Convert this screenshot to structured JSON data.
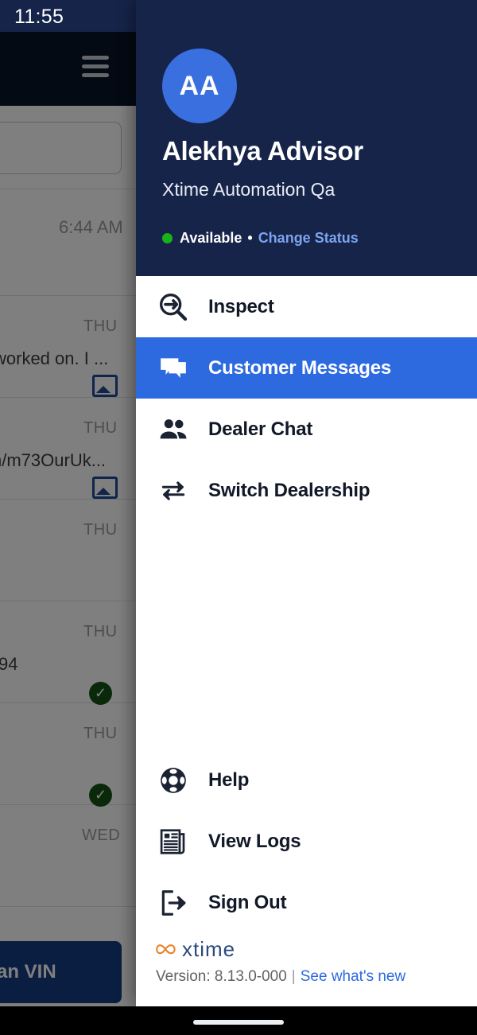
{
  "status_bar": {
    "time": "11:55",
    "icons": [
      "wifi-icon",
      "cellular-signal-icon",
      "battery-icon"
    ]
  },
  "background_app": {
    "hamburger_icon": "hamburger-menu-icon",
    "search_placeholder": "",
    "rows": [
      {
        "day": "",
        "time": "6:44 AM",
        "snippet": "",
        "has_image": false,
        "has_check": false
      },
      {
        "day": "THU",
        "time": "",
        "snippet": "worked on. I ...",
        "has_image": true,
        "has_check": false
      },
      {
        "day": "THU",
        "time": "",
        "snippet": "n/m73OurUk...",
        "has_image": true,
        "has_check": false
      },
      {
        "day": "THU",
        "time": "",
        "snippet": "",
        "has_image": false,
        "has_check": false
      },
      {
        "day": "THU",
        "time": "",
        "snippet": "94",
        "has_image": false,
        "has_check": true
      },
      {
        "day": "THU",
        "time": "",
        "snippet": "",
        "has_image": false,
        "has_check": true
      },
      {
        "day": "WED",
        "time": "",
        "snippet": "",
        "has_image": false,
        "has_check": false
      }
    ],
    "vin_button_label": "an VIN"
  },
  "drawer": {
    "avatar_initials": "AA",
    "user_name": "Alekhya Advisor",
    "organization": "Xtime Automation Qa",
    "status": {
      "indicator_color": "#19b319",
      "label": "Available",
      "separator": "•",
      "change_link": "Change Status"
    },
    "menu_top": [
      {
        "id": "inspect",
        "icon": "inspect-magnifier-wrench-icon",
        "label": "Inspect",
        "active": false
      },
      {
        "id": "customer-messages",
        "icon": "chat-bubbles-icon",
        "label": "Customer Messages",
        "active": true
      },
      {
        "id": "dealer-chat",
        "icon": "people-group-icon",
        "label": "Dealer Chat",
        "active": false
      },
      {
        "id": "switch-dealership",
        "icon": "swap-arrows-icon",
        "label": "Switch Dealership",
        "active": false
      }
    ],
    "menu_bottom": [
      {
        "id": "help",
        "icon": "lifebuoy-icon",
        "label": "Help",
        "active": false
      },
      {
        "id": "view-logs",
        "icon": "newspaper-icon",
        "label": "View Logs",
        "active": false
      },
      {
        "id": "sign-out",
        "icon": "exit-arrow-icon",
        "label": "Sign Out",
        "active": false
      }
    ],
    "footer": {
      "logo_text": "xtime",
      "logo_mark": "infinity-icon",
      "logo_mark_color": "#e8832a",
      "logo_text_color": "#2b4a7d",
      "version_label": "Version: 8.13.0-000",
      "separator": "|",
      "whats_new_link": "See what's new"
    }
  },
  "theme": {
    "header_navy": "#16244a",
    "accent_blue": "#2d6ae0",
    "link_blue": "#7ba4ef",
    "available_green": "#19b319"
  },
  "nav_bar": {
    "gesture_pill": "home-gesture-pill"
  }
}
